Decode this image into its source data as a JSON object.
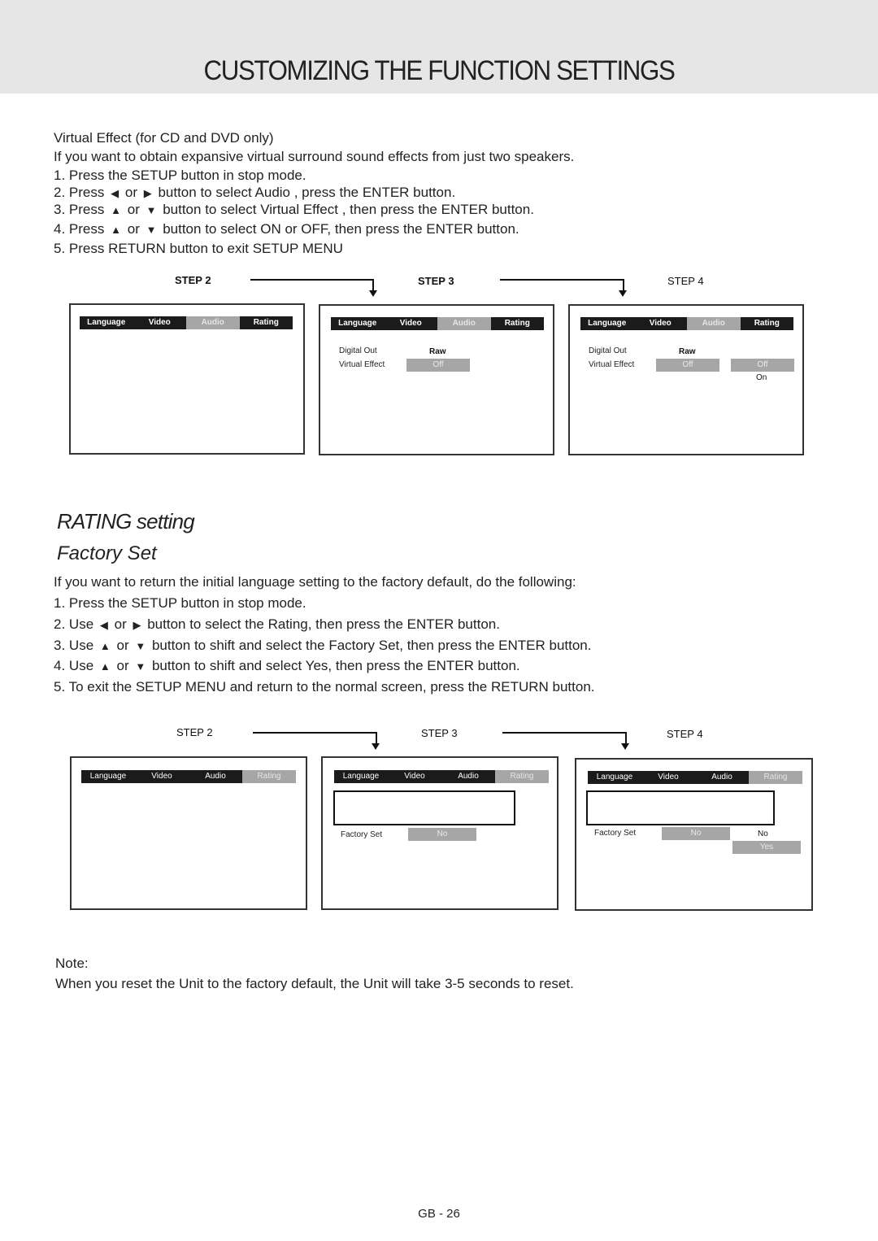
{
  "header": {
    "title": "CUSTOMIZING THE FUNCTION SETTINGS"
  },
  "virtual_effect": {
    "heading": "Virtual Effect (for CD and DVD only)",
    "intro": "If you want to obtain expansive virtual surround sound effects from just two speakers.",
    "steps": [
      {
        "num": "1.",
        "pre": "Press the SETUP button in stop mode.",
        "icon1": "",
        "mid": "",
        "icon2": "",
        "post": ""
      },
      {
        "num": "2.",
        "pre": "Press",
        "icon1": "◀",
        "mid": "or",
        "icon2": "▶",
        "post": "button to select Audio , press the ENTER button."
      },
      {
        "num": "3.",
        "pre": "Press",
        "icon1": "▲",
        "mid": "or",
        "icon2": "▼",
        "post": "button to select Virtual Effect  , then press the ENTER button."
      },
      {
        "num": "4.",
        "pre": "Press",
        "icon1": "▲",
        "mid": "or",
        "icon2": "▼",
        "post": "button to select ON or OFF, then press the ENTER button."
      },
      {
        "num": "5.",
        "pre": "Press RETURN button to exit SETUP MENU",
        "icon1": "",
        "mid": "",
        "icon2": "",
        "post": ""
      }
    ],
    "diagram": {
      "step_labels": [
        "STEP 2",
        "STEP 3",
        "STEP 4"
      ],
      "tabs": [
        "Language",
        "Video",
        "Audio",
        "Rating"
      ],
      "active_tab": "Audio",
      "digital_out_label": "Digital Out",
      "digital_out_value": "Raw",
      "virtual_effect_label": "Virtual Effect",
      "virtual_effect_value": "Off",
      "options": [
        "Off",
        "On"
      ]
    }
  },
  "rating": {
    "heading": "RATING setting",
    "subheading": "Factory Set",
    "intro": "If you want to return the initial language setting to the factory default, do the following:",
    "steps": [
      {
        "num": "1.",
        "pre": "Press the SETUP button in stop mode.",
        "icon1": "",
        "mid": "",
        "icon2": "",
        "post": ""
      },
      {
        "num": "2.",
        "pre": "Use",
        "icon1": "◀",
        "mid": "or",
        "icon2": "▶",
        "post": "button to select the Rating, then press the ENTER button."
      },
      {
        "num": "3.",
        "pre": "Use",
        "icon1": "▲",
        "mid": "or",
        "icon2": "▼",
        "post": "button to shift and select the Factory Set, then press the ENTER button."
      },
      {
        "num": "4.",
        "pre": "Use",
        "icon1": "▲",
        "mid": "or",
        "icon2": "▼",
        "post": "button to shift and select Yes, then press the ENTER button."
      },
      {
        "num": "5.",
        "pre": "To exit the SETUP MENU and return to the normal screen, press the RETURN button.",
        "icon1": "",
        "mid": "",
        "icon2": "",
        "post": ""
      }
    ],
    "diagram": {
      "step_labels": [
        "STEP 2",
        "STEP 3",
        "STEP 4"
      ],
      "tabs": [
        "Language",
        "Video",
        "Audio",
        "Rating"
      ],
      "active_tab": "Rating",
      "factory_set_label": "Factory Set",
      "factory_set_value": "No",
      "options": [
        "No",
        "Yes"
      ]
    }
  },
  "note": {
    "label": "Note:",
    "text": "When you reset the Unit to the factory default, the Unit will take 3-5 seconds to reset."
  },
  "footer": {
    "page": "GB - 26"
  }
}
